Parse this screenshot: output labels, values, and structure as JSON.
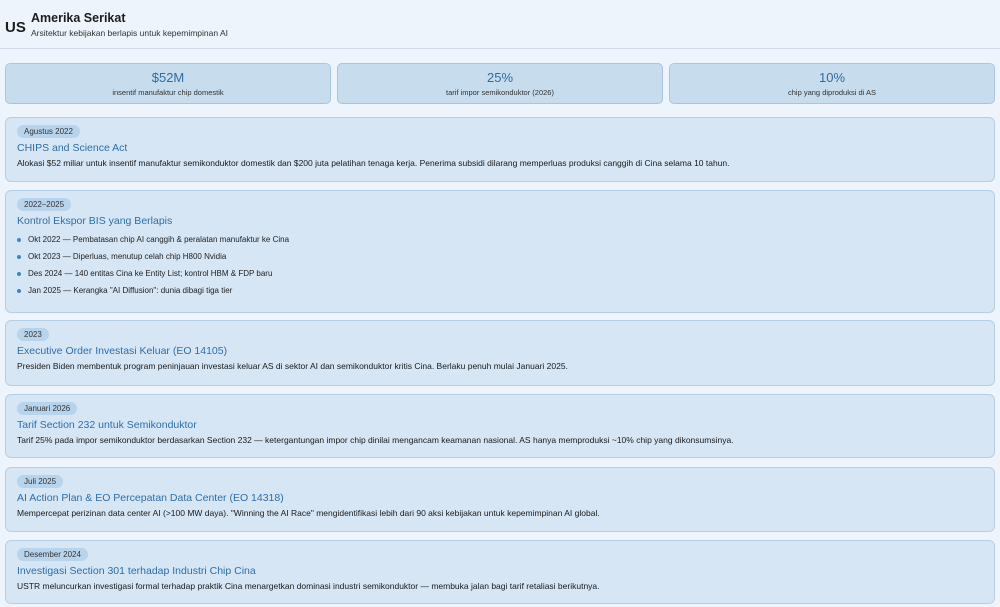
{
  "header": {
    "flag": "US",
    "title": "Amerika Serikat",
    "subtitle": "Arsitektur kebijakan berlapis untuk kepemimpinan AI"
  },
  "stats": [
    {
      "value": "$52M",
      "label": "insentif manufaktur chip domestik"
    },
    {
      "value": "25%",
      "label": "tarif impor semikonduktor (2026)"
    },
    {
      "value": "10%",
      "label": "chip yang diproduksi di AS"
    }
  ],
  "cards": [
    {
      "date": "Agustus 2022",
      "title": "CHIPS and Science Act",
      "desc": "Alokasi $52 miliar untuk insentif manufaktur semikonduktor domestik dan $200 juta pelatihan tenaga kerja. Penerima subsidi dilarang memperluas produksi canggih di Cina selama 10 tahun."
    },
    {
      "date": "2022–2025",
      "title": "Kontrol Ekspor BIS yang Berlapis",
      "bullets": [
        "Okt 2022 — Pembatasan chip AI canggih & peralatan manufaktur ke Cina",
        "Okt 2023 — Diperluas, menutup celah chip H800 Nvidia",
        "Des 2024 — 140 entitas Cina ke Entity List; kontrol HBM & FDP baru",
        "Jan 2025 — Kerangka \"AI Diffusion\": dunia dibagi tiga tier"
      ]
    },
    {
      "date": "2023",
      "title": "Executive Order Investasi Keluar (EO 14105)",
      "desc": "Presiden Biden membentuk program peninjauan investasi keluar AS di sektor AI dan semikonduktor kritis Cina. Berlaku penuh mulai Januari 2025."
    },
    {
      "date": "Januari 2026",
      "title": "Tarif Section 232 untuk Semikonduktor",
      "desc": "Tarif 25% pada impor semikonduktor berdasarkan Section 232 — ketergantungan impor chip dinilai mengancam keamanan nasional. AS hanya memproduksi ~10% chip yang dikonsumsinya."
    },
    {
      "date": "Juli 2025",
      "title": "AI Action Plan & EO Percepatan Data Center (EO 14318)",
      "desc": "Mempercepat perizinan data center AI (>100 MW daya). \"Winning the AI Race\" mengidentifikasi lebih dari 90 aksi kebijakan untuk kepemimpinan AI global."
    },
    {
      "date": "Desember 2024",
      "title": "Investigasi Section 301 terhadap Industri Chip Cina",
      "desc": "USTR meluncurkan investigasi formal terhadap praktik Cina menargetkan dominasi industri semikonduktor — membuka jalan bagi tarif retaliasi berikutnya."
    }
  ]
}
